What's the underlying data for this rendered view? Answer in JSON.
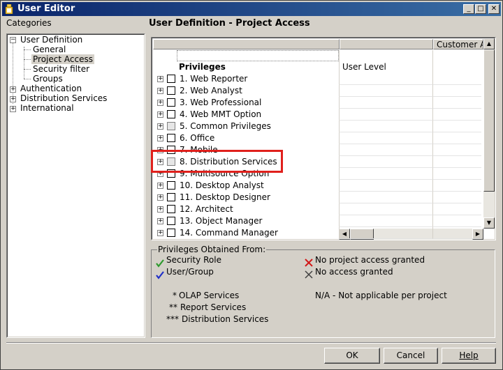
{
  "window": {
    "title": "User Editor"
  },
  "categories": {
    "label": "Categories",
    "tree": [
      {
        "label": "User Definition",
        "expander": "−"
      },
      {
        "label": "General"
      },
      {
        "label": "Project Access"
      },
      {
        "label": "Security filter"
      },
      {
        "label": "Groups"
      },
      {
        "label": "Authentication",
        "expander": "+"
      },
      {
        "label": "Distribution Services",
        "expander": "+"
      },
      {
        "label": "International",
        "expander": "+"
      }
    ],
    "selected": "Project Access"
  },
  "panel": {
    "title": "User Definition - Project Access"
  },
  "grid": {
    "col_customer": "Customer A",
    "col_privileges": "Privileges",
    "col_user_level": "User Level",
    "rows": [
      {
        "label": "1. Web Reporter",
        "checked_state": "empty"
      },
      {
        "label": "2. Web Analyst",
        "checked_state": "empty"
      },
      {
        "label": "3. Web Professional",
        "checked_state": "empty"
      },
      {
        "label": "4. Web MMT Option",
        "checked_state": "empty"
      },
      {
        "label": "5. Common Privileges",
        "checked_state": "grey"
      },
      {
        "label": "6. Office",
        "checked_state": "empty"
      },
      {
        "label": "7. Mobile",
        "checked_state": "empty"
      },
      {
        "label": "8. Distribution Services",
        "checked_state": "grey"
      },
      {
        "label": "9. Multisource Option",
        "checked_state": "empty"
      },
      {
        "label": "10. Desktop Analyst",
        "checked_state": "empty"
      },
      {
        "label": "11. Desktop Designer",
        "checked_state": "empty"
      },
      {
        "label": "12. Architect",
        "checked_state": "empty"
      },
      {
        "label": "13. Object Manager",
        "checked_state": "empty"
      },
      {
        "label": "14. Command Manager",
        "checked_state": "empty"
      }
    ]
  },
  "legend": {
    "title": "Privileges Obtained From:",
    "security_role": "Security Role",
    "user_group": "User/Group",
    "no_project_access": "No project access granted",
    "no_access": "No access granted",
    "olap_marker": "*",
    "olap": "OLAP Services",
    "report_marker": "**",
    "report": "Report Services",
    "distribution_marker": "***",
    "distribution": "Distribution Services",
    "na": "N/A - Not applicable per project",
    "colors": {
      "green": "#2e9b2e",
      "blue": "#2030c8",
      "red": "#d01818",
      "grey": "#404040"
    }
  },
  "buttons": {
    "ok": "OK",
    "cancel": "Cancel",
    "help": "Help"
  }
}
